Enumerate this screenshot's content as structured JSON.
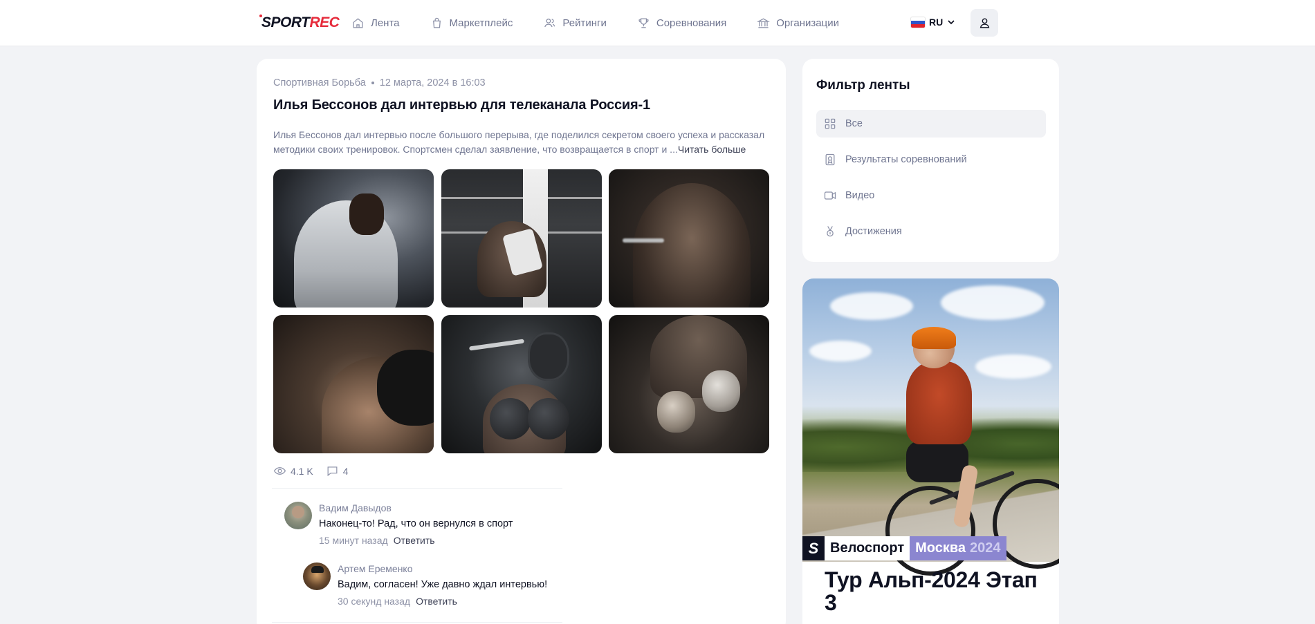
{
  "header": {
    "logo": {
      "part1": "SPORT",
      "part2": "REC"
    },
    "nav": [
      {
        "label": "Лента",
        "icon": "home-icon"
      },
      {
        "label": "Маркетплейс",
        "icon": "bag-icon"
      },
      {
        "label": "Рейтинги",
        "icon": "users-icon"
      },
      {
        "label": "Соревнования",
        "icon": "trophy-icon"
      },
      {
        "label": "Организации",
        "icon": "bank-icon"
      }
    ],
    "language": "RU"
  },
  "post": {
    "category": "Спортивная Борьба",
    "date": "12 марта, 2024 в 16:03",
    "title": "Илья Бессонов дал интервью для телеканала Россия-1",
    "excerpt": "Илья Бессонов дал интервью после большого перерыва, где поделился секретом своего успеха и рассказал методики своих тренировок. Спортсмен сделал заявление, что возвращается в спорт и ...",
    "read_more": "Читать больше",
    "views": "4.1 K",
    "comments_count": "4",
    "comments": [
      {
        "author": "Вадим Давыдов",
        "text": "Наконец-то! Рад, что он вернулся в спорт",
        "time": "15 минут назад",
        "reply_label": "Ответить"
      },
      {
        "author": "Артем Еременко",
        "text": "Вадим, согласен! Уже давно ждал интервью!",
        "time": "30 секунд назад",
        "reply_label": "Ответить"
      }
    ]
  },
  "filter": {
    "title": "Фильтр ленты",
    "items": [
      {
        "label": "Все",
        "icon": "grid-icon",
        "active": true
      },
      {
        "label": "Результаты соревнований",
        "icon": "certificate-icon",
        "active": false
      },
      {
        "label": "Видео",
        "icon": "video-icon",
        "active": false
      },
      {
        "label": "Достижения",
        "icon": "medal-icon",
        "active": false
      }
    ]
  },
  "banner": {
    "sport": "Велоспорт",
    "city": "Москва",
    "year": "2024",
    "title": "Тур Альп-2024 Этап 3",
    "logo_letter": "S"
  },
  "colors": {
    "brand_red": "#e62b3b",
    "text_dark": "#0f1222",
    "text_muted": "#6f7590",
    "accent_purple": "#8b86d0",
    "background": "#f2f3f6"
  }
}
